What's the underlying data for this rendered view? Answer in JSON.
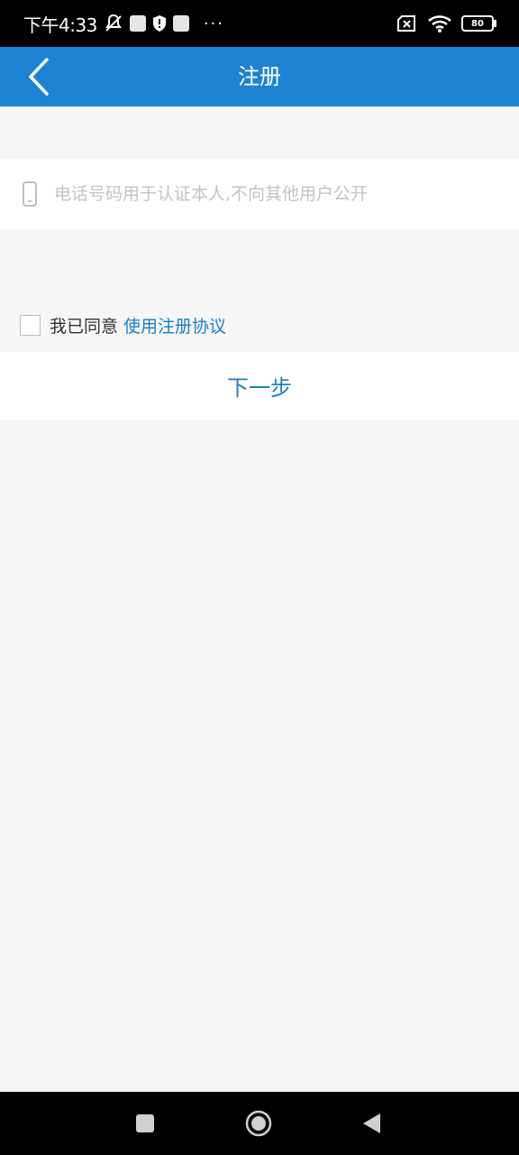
{
  "status_bar": {
    "time": "下午4:33",
    "battery": "80",
    "icons": [
      "mute-icon",
      "notification-icon",
      "shield-icon",
      "notification-icon",
      "more-icon",
      "sim-off-icon",
      "wifi-icon",
      "battery-icon"
    ]
  },
  "app_bar": {
    "title": "注册",
    "back_icon": "chevron-left-icon"
  },
  "form": {
    "phone_icon": "phone-icon",
    "phone_value": "",
    "phone_placeholder": "电话号码用于认证本人,不向其他用户公开"
  },
  "agreement": {
    "checked": false,
    "prefix": "我已同意",
    "link_label": "使用注册协议"
  },
  "next_button": {
    "label": "下一步"
  },
  "nav_bar": {
    "recent_icon": "square-icon",
    "home_icon": "circle-home-icon",
    "back_icon": "triangle-back-icon"
  },
  "colors": {
    "accent": "#1e82d2",
    "link": "#1a7fc4",
    "background": "#f6f6f6"
  }
}
